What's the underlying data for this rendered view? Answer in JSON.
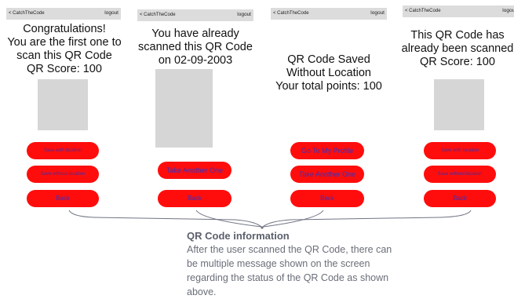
{
  "app": {
    "back_label": "< CatchTheCode",
    "logout_label": "logout"
  },
  "screens": [
    {
      "message_lines": [
        "Congratulations!",
        "You are the first one to",
        "scan this QR Code",
        "QR Score: 100"
      ],
      "buttons": [
        "Save with location",
        "Save without location",
        "Back"
      ]
    },
    {
      "message_lines": [
        "You have already",
        "scanned this QR Code",
        "on 02-09-2003"
      ],
      "buttons": [
        "Take Another One",
        "Back"
      ]
    },
    {
      "message_lines": [
        "QR Code Saved",
        "Without Location",
        "Your total points: 100"
      ],
      "buttons": [
        "Go To My Profile",
        "Take Another One",
        "Back"
      ]
    },
    {
      "message_lines": [
        "This QR Code has",
        "already been scanned",
        "QR Score: 100"
      ],
      "buttons": [
        "Save with location",
        "Save without location",
        "Back"
      ]
    }
  ],
  "info": {
    "title": "QR Code information",
    "body": "After the user scanned the QR Code, there can be multiple message shown on the screen regarding the status of the QR Code as shown above."
  }
}
